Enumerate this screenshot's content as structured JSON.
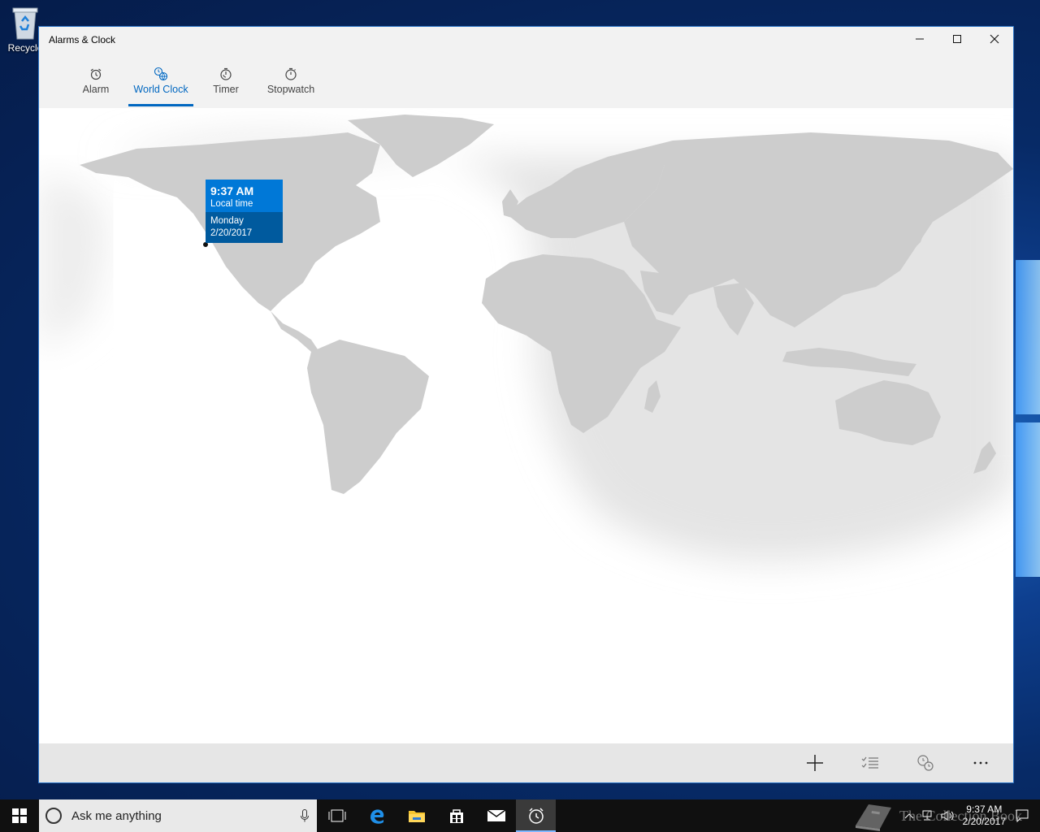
{
  "desktop": {
    "recycle_label": "Recycle"
  },
  "window": {
    "title": "Alarms & Clock",
    "tabs": [
      {
        "label": "Alarm",
        "icon": "alarm-icon",
        "active": false
      },
      {
        "label": "World Clock",
        "icon": "world-clock-icon",
        "active": true
      },
      {
        "label": "Timer",
        "icon": "timer-icon",
        "active": false
      },
      {
        "label": "Stopwatch",
        "icon": "stopwatch-icon",
        "active": false
      }
    ]
  },
  "clock_card": {
    "time": "9:37 AM",
    "subtitle": "Local time",
    "day": "Monday",
    "date": "2/20/2017"
  },
  "commandbar": {
    "icons": [
      "add-icon",
      "select-icon",
      "compare-icon",
      "more-icon"
    ]
  },
  "taskbar": {
    "search_placeholder": "Ask me anything",
    "time": "9:37 AM",
    "date": "2/20/2017",
    "watermark": "The Collection Book"
  },
  "colors": {
    "accent": "#0078d7",
    "accent_dark": "#005a9e",
    "land": "#cfcfcf",
    "night_shade": "#e6e6e6"
  }
}
